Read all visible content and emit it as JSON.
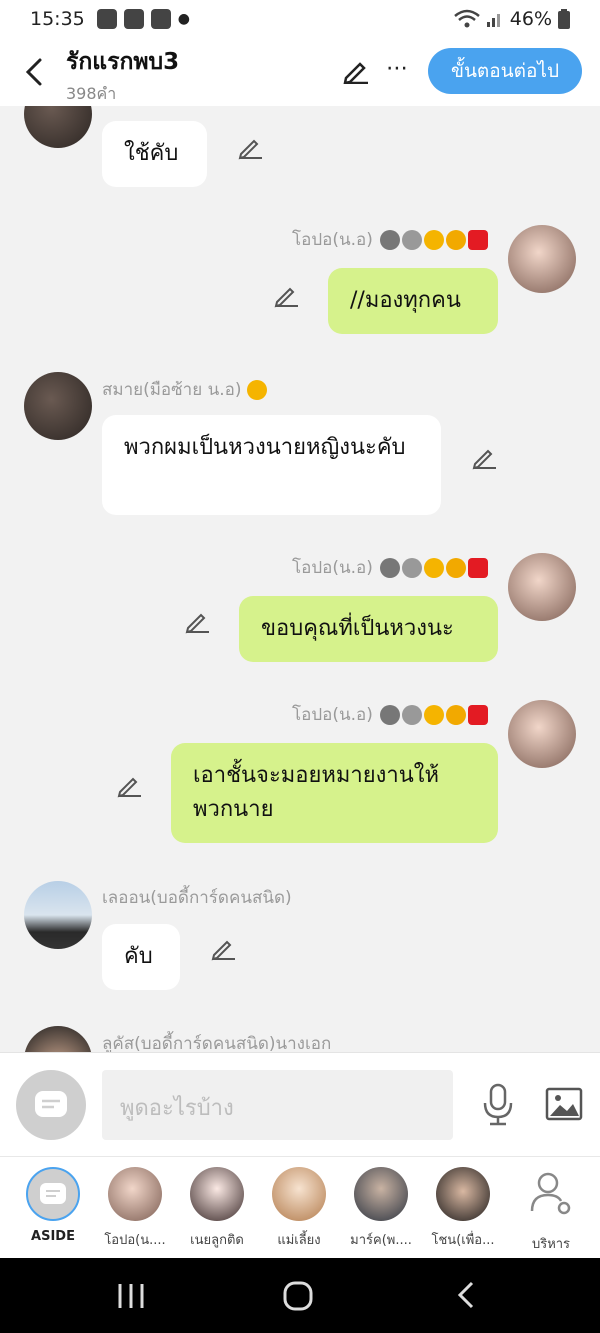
{
  "status": {
    "time": "15:35",
    "battery": "46%"
  },
  "header": {
    "title": "รักแรกพบ3",
    "subtitle": "398คำ",
    "next_label": "ขั้นตอนต่อไป"
  },
  "messages": [
    {
      "text": "ใช้คับ",
      "side": "left"
    },
    {
      "sender": "โอปอ(น.อ)",
      "text": "//มองทุกคน",
      "side": "right"
    },
    {
      "sender": "สมาย(มือซ้าย น.อ)",
      "text": "พวกผมเป็นหวงนายหญิงนะคับ",
      "side": "left"
    },
    {
      "sender": "โอปอ(น.อ)",
      "text": "ขอบคุณที่เป็นหวงนะ",
      "side": "right"
    },
    {
      "sender": "โอปอ(น.อ)",
      "text": "เอาชั้นจะมอยหมายงานให้พวกนาย",
      "side": "right"
    },
    {
      "sender": "เลออน(บอดี้การ์ดคนสนิด)",
      "text": "คับ",
      "side": "left"
    },
    {
      "sender": "ลูคัส(บอดี้การ์ดคนสนิด)นางเอก",
      "text": "",
      "side": "left"
    }
  ],
  "input": {
    "placeholder": "พูดอะไรบ้าง"
  },
  "characters": [
    {
      "label": "ASIDE"
    },
    {
      "label": "โอปอ(น...."
    },
    {
      "label": "เนยลูกติด"
    },
    {
      "label": "แม่เลี้ยง"
    },
    {
      "label": "มาร์ค(พ...."
    },
    {
      "label": "โชน(เพื่อ..."
    },
    {
      "label": "บริหาร"
    }
  ]
}
